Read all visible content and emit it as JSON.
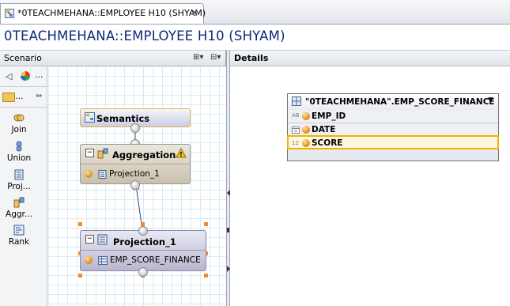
{
  "tab": {
    "label": "*0TEACHMEHANA::EMPLOYEE H10 (SHYAM)",
    "close_glyph": "✕"
  },
  "title": "0TEACHMEHANA::EMPLOYEE H10 (SHYAM)",
  "scenario": {
    "header": "Scenario",
    "palette_dots": "...",
    "tools_dots": "...",
    "tools": [
      {
        "label": "Join",
        "icon": "join-icon"
      },
      {
        "label": "Union",
        "icon": "union-icon"
      },
      {
        "label": "Proj...",
        "icon": "projection-icon"
      },
      {
        "label": "Aggr...",
        "icon": "aggregation-icon"
      },
      {
        "label": "Rank",
        "icon": "rank-icon"
      }
    ],
    "nodes": {
      "semantics": {
        "label": "Semantics"
      },
      "aggregation": {
        "label": "Aggregation",
        "input": "Projection_1",
        "warning": "!"
      },
      "projection": {
        "label": "Projection_1",
        "input": "EMP_SCORE_FINANCE"
      }
    }
  },
  "details": {
    "header": "Details",
    "table": {
      "name": "\"0TEACHMEHANA\".EMP_SCORE_FINANCE",
      "columns": [
        {
          "type": "AB",
          "name": "EMP_ID"
        },
        {
          "type": "",
          "name": "DATE"
        },
        {
          "type": "12",
          "name": "SCORE",
          "selected": true
        }
      ]
    }
  },
  "colors": {
    "title": "#0b2a78",
    "selection": "#f0b400",
    "node_handle": "#f28c1e"
  }
}
